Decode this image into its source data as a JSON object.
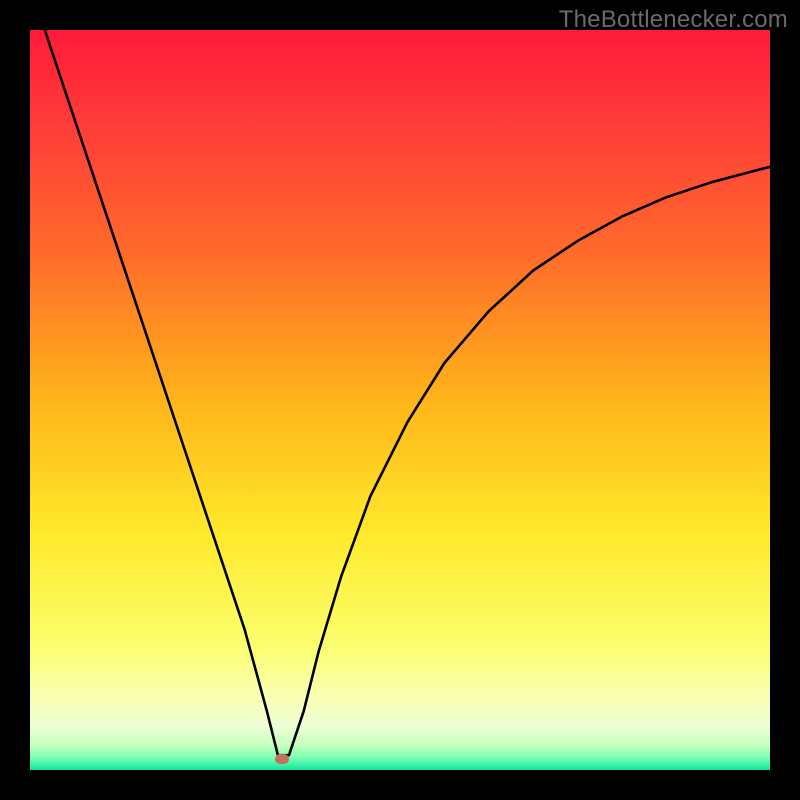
{
  "watermark": "TheBottlenecker.com",
  "colors": {
    "frame": "#000000",
    "gradient_stops": [
      {
        "offset": 0.0,
        "color": "#ff1a3a"
      },
      {
        "offset": 0.12,
        "color": "#ff3a3a"
      },
      {
        "offset": 0.3,
        "color": "#ff6a2a"
      },
      {
        "offset": 0.5,
        "color": "#ffb41a"
      },
      {
        "offset": 0.68,
        "color": "#ffe92a"
      },
      {
        "offset": 0.83,
        "color": "#fbff6d"
      },
      {
        "offset": 0.9,
        "color": "#f9ffb0"
      },
      {
        "offset": 0.94,
        "color": "#efffd6"
      },
      {
        "offset": 0.965,
        "color": "#c9ffbf"
      },
      {
        "offset": 0.983,
        "color": "#7dffb3"
      },
      {
        "offset": 1.0,
        "color": "#10e69d"
      }
    ],
    "curve": "#000000",
    "marker": "#c76e5e"
  },
  "chart_data": {
    "type": "line",
    "title": "",
    "xlabel": "",
    "ylabel": "",
    "xlim": [
      0,
      100
    ],
    "ylim": [
      0,
      100
    ],
    "grid": false,
    "series": [
      {
        "name": "bottleneck-curve",
        "x": [
          2,
          5,
          8,
          11,
          14,
          17,
          20,
          23,
          26,
          29,
          32,
          33.5,
          35,
          37,
          39,
          42,
          46,
          51,
          56,
          62,
          68,
          74,
          80,
          86,
          92,
          98,
          100
        ],
        "y": [
          100,
          91,
          82,
          73,
          64,
          55,
          46,
          37,
          28,
          19,
          8,
          2,
          2,
          8,
          16,
          26,
          37,
          47,
          55,
          62,
          67.5,
          71.5,
          74.8,
          77.4,
          79.4,
          81,
          81.5
        ]
      }
    ],
    "annotations": [
      {
        "name": "optimal-point",
        "x": 34,
        "y": 1.5
      }
    ]
  }
}
